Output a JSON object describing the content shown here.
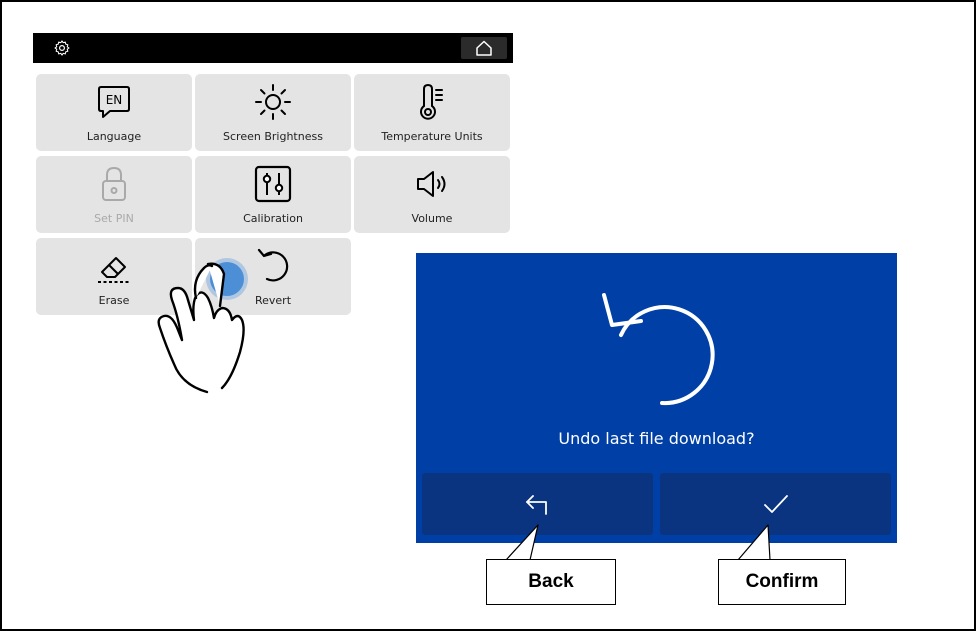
{
  "panel": {
    "header": {
      "settings_icon": "gear-icon",
      "home_icon": "home-icon"
    },
    "tiles": [
      {
        "label": "Language",
        "icon": "language-en-icon",
        "icon_text": "EN"
      },
      {
        "label": "Screen Brightness",
        "icon": "brightness-icon"
      },
      {
        "label": "Temperature Units",
        "icon": "thermometer-icon"
      },
      {
        "label": "Set PIN",
        "icon": "lock-icon",
        "disabled": true
      },
      {
        "label": "Calibration",
        "icon": "calibration-sliders-icon"
      },
      {
        "label": "Volume",
        "icon": "speaker-icon"
      },
      {
        "label": "Erase",
        "icon": "eraser-icon"
      },
      {
        "label": "Revert",
        "icon": "revert-icon"
      }
    ]
  },
  "dialog": {
    "message": "Undo last file download?",
    "back_icon": "back-arrow-icon",
    "confirm_icon": "checkmark-icon",
    "background_color": "#0040a6",
    "button_color": "#0a3480"
  },
  "callouts": {
    "back": "Back",
    "confirm": "Confirm"
  }
}
